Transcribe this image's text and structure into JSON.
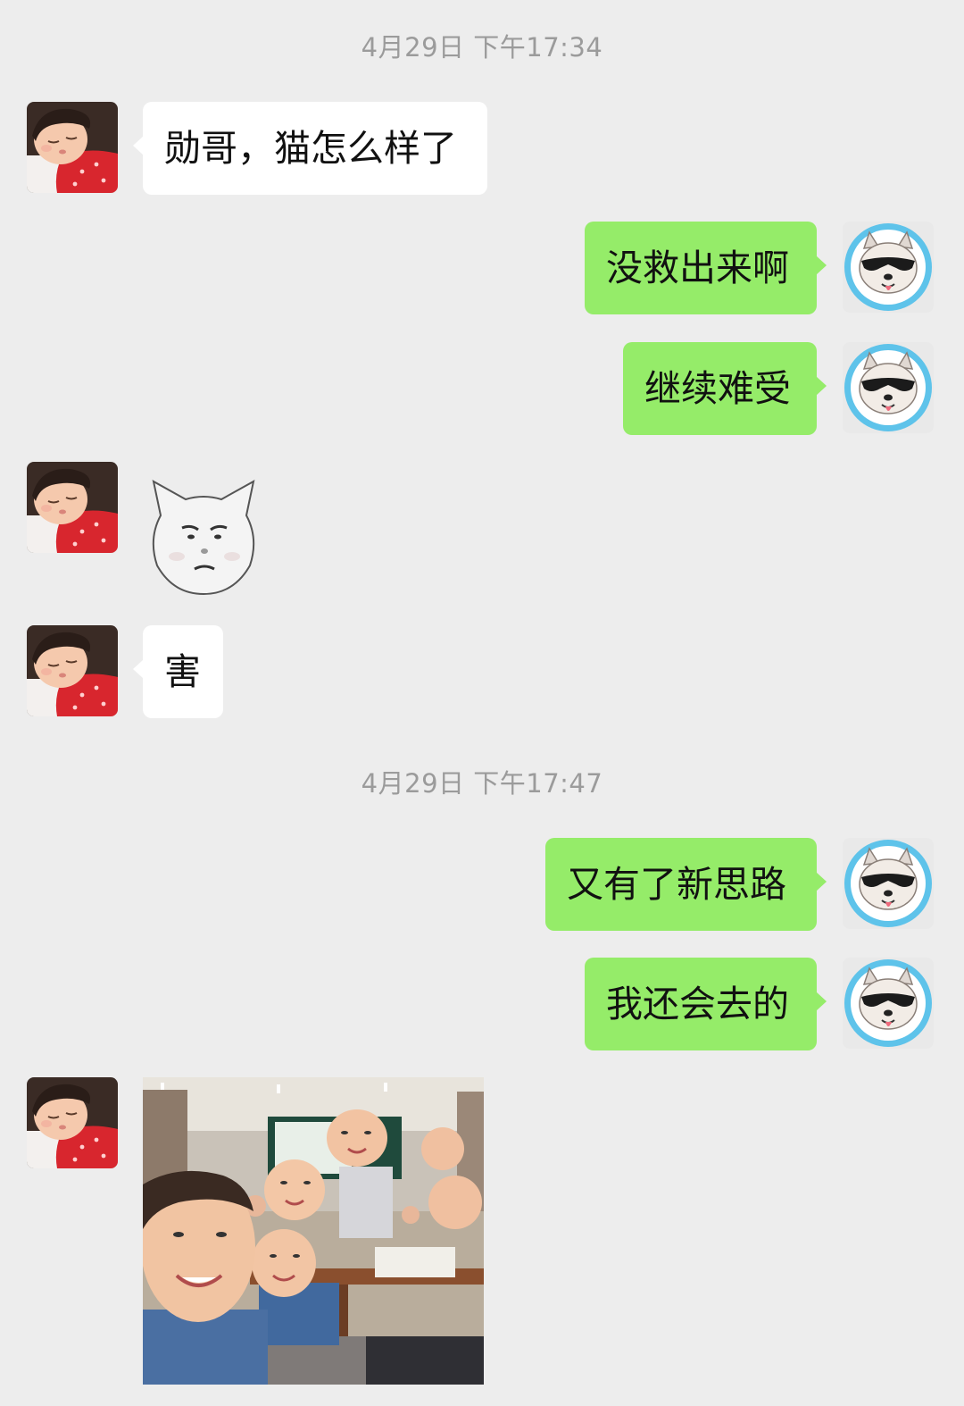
{
  "timestamps": [
    "4月29日 下午17:34",
    "4月29日 下午17:47"
  ],
  "messages": [
    {
      "side": "in",
      "type": "text",
      "text": "勋哥，猫怎么样了"
    },
    {
      "side": "out",
      "type": "text",
      "text": "没救出来啊"
    },
    {
      "side": "out",
      "type": "text",
      "text": "继续难受"
    },
    {
      "side": "in",
      "type": "sticker",
      "icon": "pouting-cat-face-sticker"
    },
    {
      "side": "in",
      "type": "text",
      "text": "害"
    },
    {
      "side": "out",
      "type": "text",
      "text": "又有了新思路"
    },
    {
      "side": "out",
      "type": "text",
      "text": "我还会去的"
    },
    {
      "side": "in",
      "type": "image",
      "icon": "classroom-kids-photo"
    }
  ],
  "colors": {
    "background": "#ededed",
    "incoming_bubble": "#ffffff",
    "outgoing_bubble": "#95ec69",
    "timestamp_text": "#9b9b9b"
  },
  "avatars": {
    "incoming": "child-sleeping-avatar-icon",
    "outgoing": "dog-with-sunglasses-avatar-icon"
  }
}
